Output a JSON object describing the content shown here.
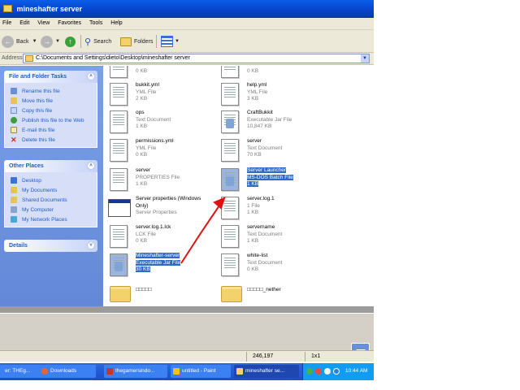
{
  "window": {
    "title": "mineshafter server"
  },
  "menu": [
    "File",
    "Edit",
    "View",
    "Favorites",
    "Tools",
    "Help"
  ],
  "toolbar": {
    "back": "Back",
    "search": "Search",
    "folders": "Folders"
  },
  "address": {
    "label": "Address",
    "path": "C:\\Documents and Settings\\dieto\\Desktop\\mineshafter server"
  },
  "tasks_panel": {
    "title": "File and Folder Tasks",
    "items": [
      "Rename this file",
      "Move this file",
      "Copy this file",
      "Publish this file to the Web",
      "E-mail this file",
      "Delete this file"
    ]
  },
  "other_places": {
    "title": "Other Places",
    "items": [
      "Desktop",
      "My Documents",
      "Shared Documents",
      "My Computer",
      "My Network Places"
    ]
  },
  "details": {
    "title": "Details"
  },
  "files": [
    {
      "name": "",
      "type": "",
      "size": "0 KB"
    },
    {
      "name": "",
      "type": "Text Document",
      "size": "0 KB"
    },
    {
      "name": "bukkit.yml",
      "type": "YML File",
      "size": "2 KB"
    },
    {
      "name": "help.yml",
      "type": "YML File",
      "size": "3 KB"
    },
    {
      "name": "ops",
      "type": "Text Document",
      "size": "1 KB"
    },
    {
      "name": "CraftBukkit",
      "type": "Executable Jar File",
      "size": "10,847 KB"
    },
    {
      "name": "permissions.yml",
      "type": "YML File",
      "size": "0 KB"
    },
    {
      "name": "server",
      "type": "Text Document",
      "size": "70 KB"
    },
    {
      "name": "server",
      "type": "PROPERTIES File",
      "size": "1 KB"
    },
    {
      "name": "Server Launcher",
      "type": "MS-DOS Batch File",
      "size": "1 KB"
    },
    {
      "name": "Server properties (Windows Only)",
      "type": "Server Properties",
      "size": ""
    },
    {
      "name": "server.log.1",
      "type": "1 File",
      "size": "1 KB"
    },
    {
      "name": "server.log.1.lck",
      "type": "LCK File",
      "size": "0 KB"
    },
    {
      "name": "servername",
      "type": "Text Document",
      "size": "1 KB"
    },
    {
      "name": "Mineshafter-server",
      "type": "Executable Jar File",
      "size": "30 KB"
    },
    {
      "name": "white-list",
      "type": "Text Document",
      "size": "0 KB"
    },
    {
      "name": "□□□□□",
      "type": "",
      "size": ""
    },
    {
      "name": "□□□□□_nether",
      "type": "",
      "size": ""
    }
  ],
  "statusbar": {
    "coords": "246,197",
    "size": "1x1"
  },
  "taskbar": {
    "tasks": [
      "er: THEg...",
      "Downloads",
      "thegamersindo...",
      "untitled - Paint",
      "mineshafter se..."
    ],
    "clock": "10:44 AM"
  },
  "colors": {
    "selection": "#316ac5",
    "arrow": "#e01010",
    "titlebar": "#0842c8",
    "taskbar": "#245edb"
  }
}
